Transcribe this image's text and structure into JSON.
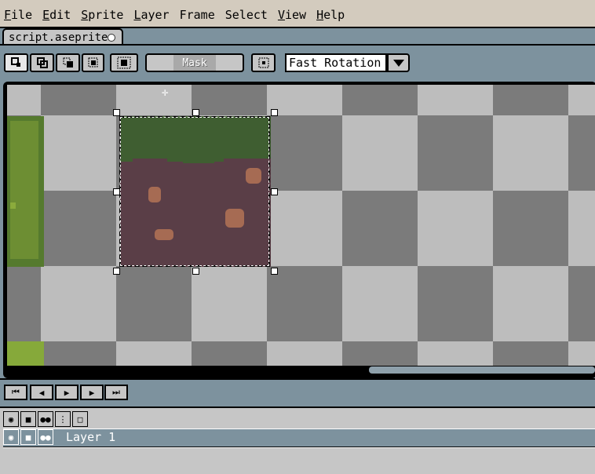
{
  "menu": [
    {
      "u": "F",
      "rest": "ile"
    },
    {
      "u": "E",
      "rest": "dit"
    },
    {
      "u": "S",
      "rest": "prite"
    },
    {
      "u": "L",
      "rest": "ayer"
    },
    {
      "u": "F",
      "rest": "rame"
    },
    {
      "u": "S",
      "rest": "elect"
    },
    {
      "u": "V",
      "rest": "iew"
    },
    {
      "u": "H",
      "rest": "elp"
    }
  ],
  "tab": {
    "title": "script.aseprite"
  },
  "toolbar": {
    "mask_label": "Mask",
    "rotation_value": "Fast Rotation",
    "icons": [
      "selection-replace-icon",
      "selection-add-icon",
      "selection-subtract-icon",
      "selection-intersect-icon",
      "transparent-color-icon",
      "pivot-icon"
    ]
  },
  "playback": [
    "first-frame-icon",
    "previous-frame-icon",
    "play-icon",
    "next-frame-icon",
    "last-frame-icon"
  ],
  "layers": {
    "header_icons": [
      "eye-icon",
      "lock-icon",
      "link-icon",
      "continuous-icon",
      "frame-icon"
    ],
    "rows": [
      {
        "name": "Layer 1"
      }
    ]
  },
  "colors": {
    "grass": "#3f5e31",
    "dirt": "#5a3e47",
    "spots": "#a66b53",
    "panel": "#7d929e"
  }
}
